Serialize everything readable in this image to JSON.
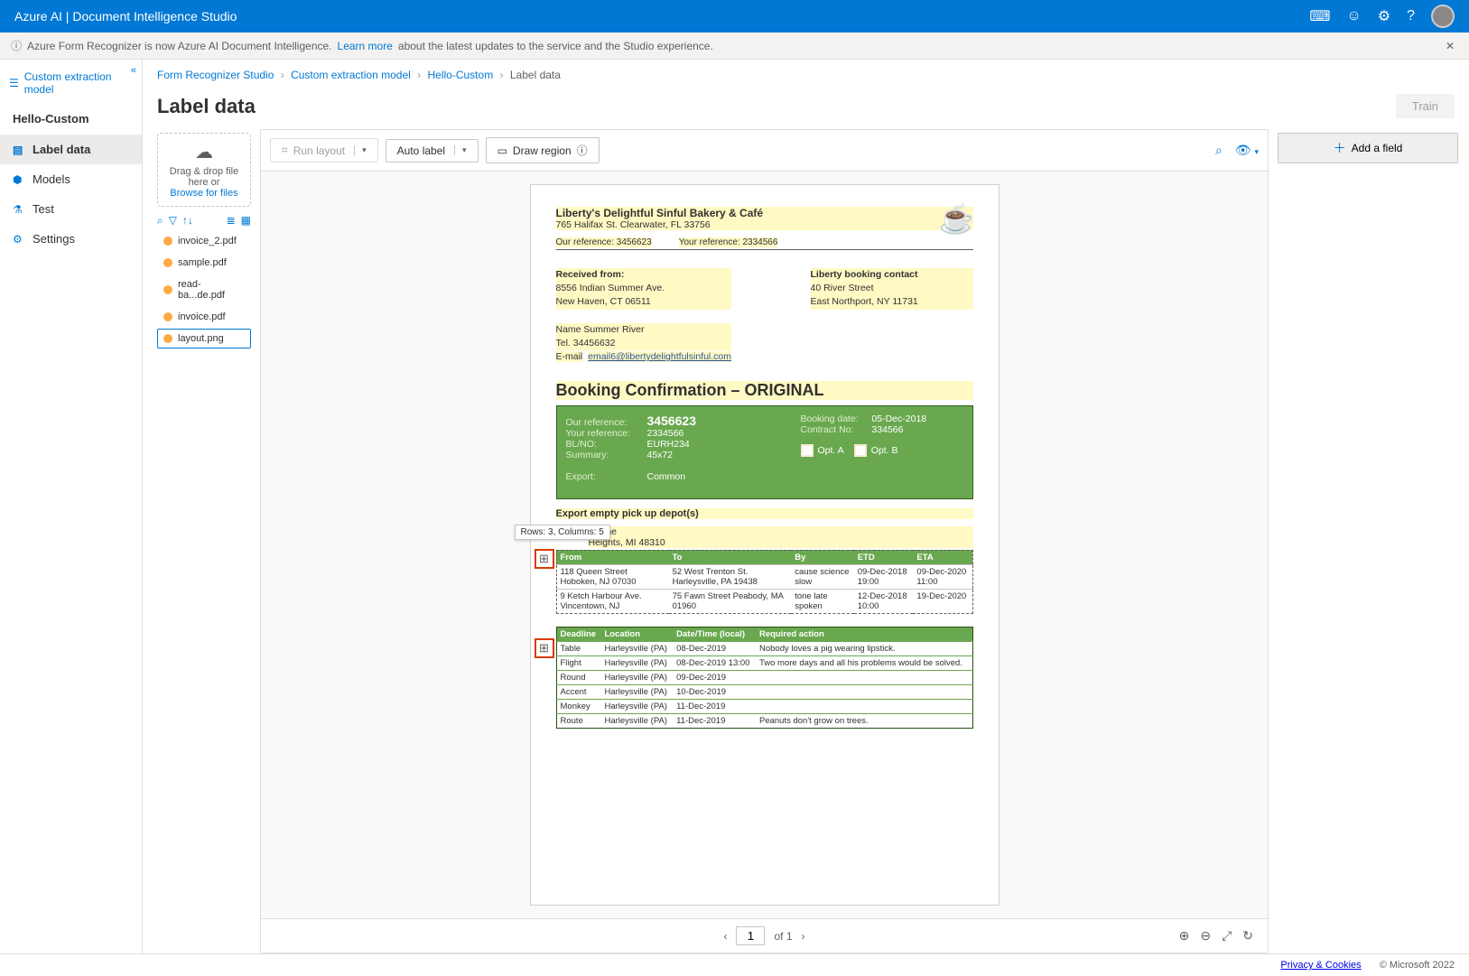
{
  "topbar": {
    "title": "Azure AI | Document Intelligence Studio"
  },
  "banner": {
    "info_icon": "ⓘ",
    "text": "Azure Form Recognizer is now Azure AI Document Intelligence.",
    "link": "Learn more",
    "suffix": "about the latest updates to the service and the Studio experience."
  },
  "sidebar": {
    "collapse": "«",
    "heading": "Custom extraction model",
    "project": "Hello-Custom",
    "items": [
      {
        "label": "Label data",
        "icon": "▤"
      },
      {
        "label": "Models",
        "icon": "⬢"
      },
      {
        "label": "Test",
        "icon": "⚗"
      },
      {
        "label": "Settings",
        "icon": "⚙"
      }
    ]
  },
  "breadcrumb": {
    "a": "Form Recognizer Studio",
    "b": "Custom extraction model",
    "c": "Hello-Custom",
    "d": "Label data"
  },
  "header": {
    "title": "Label data",
    "train": "Train"
  },
  "filepanel": {
    "drop1": "Drag & drop file here or",
    "browse": "Browse for files",
    "files": [
      "invoice_2.pdf",
      "sample.pdf",
      "read-ba...de.pdf",
      "invoice.pdf",
      "layout.png"
    ]
  },
  "toolbar": {
    "run_layout": "Run layout",
    "auto_label": "Auto label",
    "draw_region": "Draw region"
  },
  "fields": {
    "add": "Add a field"
  },
  "doc": {
    "company": "Liberty's Delightful Sinful Bakery & Café",
    "addr": "765 Halifax St. Clearwater, FL 33756",
    "ourref_l": "Our reference: 3456623",
    "yourref_l": "Your reference: 2334566",
    "recv_h": "Received from:",
    "recv1": "8556 Indian Summer Ave.",
    "recv2": "New Haven, CT 06511",
    "name": "Name Summer River",
    "tel": "Tel. 34456632",
    "email_l": "E-mail",
    "email_v": "email6@libertydelightfulsinful.com",
    "contact_h": "Liberty booking contact",
    "contact1": "40 River Street",
    "contact2": "East Northport, NY 11731",
    "booking_h": "Booking Confirmation – ORIGINAL",
    "gp": {
      "ourref_l": "Our reference:",
      "ourref_v": "3456623",
      "yourref_l": "Your reference:",
      "yourref_v": "2334566",
      "blno_l": "BL/NO:",
      "blno_v": "EURH234",
      "summary_l": "Summary:",
      "summary_v": "45x72",
      "export_l": "Export:",
      "export_v": "Common",
      "bdate_l": "Booking date:",
      "bdate_v": "05-Dec-2018",
      "cno_l": "Contract No:",
      "cno_v": "334566",
      "opta": "Opt. A",
      "optb": "Opt. B"
    },
    "depot_h": "Export empty pick up depot(s)",
    "depot_addr1": "s Lane",
    "depot_addr2": "Heights, MI 48310",
    "tooltip": "Rows: 3, Columns: 5",
    "t1": {
      "head": [
        "From",
        "To",
        "By",
        "ETD",
        "ETA"
      ],
      "rows": [
        [
          "118 Queen Street Hoboken, NJ 07030",
          "52 West Trenton St. Harleysville, PA 19438",
          "cause science slow",
          "09-Dec-2018 19:00",
          "09-Dec-2020 11:00"
        ],
        [
          "9 Ketch Harbour Ave. Vincentown, NJ",
          "75 Fawn Street Peabody, MA 01960",
          "tone late spoken",
          "12-Dec-2018 10:00",
          "19-Dec-2020"
        ]
      ]
    },
    "t2": {
      "head": [
        "Deadline",
        "Location",
        "Date/Time (local)",
        "Required action"
      ],
      "rows": [
        [
          "Table",
          "Harleysville (PA)",
          "08-Dec-2019",
          "Nobody loves a pig wearing lipstick."
        ],
        [
          "Flight",
          "Harleysville (PA)",
          "08-Dec-2019 13:00",
          "Two more days and all his problems would be solved."
        ],
        [
          "Round",
          "Harleysville (PA)",
          "09-Dec-2019",
          ""
        ],
        [
          "Accent",
          "Harleysville (PA)",
          "10-Dec-2019",
          ""
        ],
        [
          "Monkey",
          "Harleysville (PA)",
          "11-Dec-2019",
          ""
        ],
        [
          "Route",
          "Harleysville (PA)",
          "11-Dec-2019",
          "Peanuts don't grow on trees."
        ]
      ]
    }
  },
  "pager": {
    "page": "1",
    "of": "of 1"
  },
  "footer": {
    "privacy": "Privacy & Cookies",
    "copy": "© Microsoft 2022"
  }
}
